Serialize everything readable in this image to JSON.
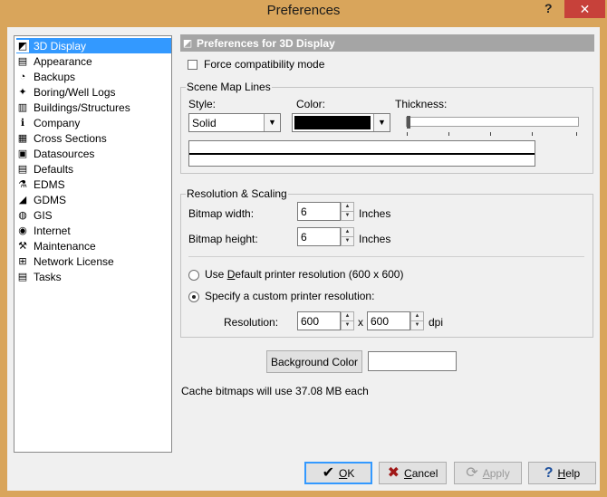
{
  "window": {
    "title": "Preferences",
    "help_glyph": "?",
    "close_glyph": "✕"
  },
  "nav": {
    "items": [
      {
        "label": "3D Display",
        "icon": "3d-display-icon",
        "glyph": "◩",
        "selected": true
      },
      {
        "label": "Appearance",
        "icon": "appearance-icon",
        "glyph": "▤"
      },
      {
        "label": "Backups",
        "icon": "backups-icon",
        "glyph": "◔"
      },
      {
        "label": "Boring/Well Logs",
        "icon": "boring-well-logs-icon",
        "glyph": "✦"
      },
      {
        "label": "Buildings/Structures",
        "icon": "buildings-icon",
        "glyph": "▥"
      },
      {
        "label": "Company",
        "icon": "company-icon",
        "glyph": "ℹ"
      },
      {
        "label": "Cross Sections",
        "icon": "cross-sections-icon",
        "glyph": "▦"
      },
      {
        "label": "Datasources",
        "icon": "datasources-icon",
        "glyph": "▣"
      },
      {
        "label": "Defaults",
        "icon": "defaults-icon",
        "glyph": "▤"
      },
      {
        "label": "EDMS",
        "icon": "edms-icon",
        "glyph": "⚗"
      },
      {
        "label": "GDMS",
        "icon": "gdms-icon",
        "glyph": "◢"
      },
      {
        "label": "GIS",
        "icon": "gis-icon",
        "glyph": "◍"
      },
      {
        "label": "Internet",
        "icon": "internet-icon",
        "glyph": "◉"
      },
      {
        "label": "Maintenance",
        "icon": "maintenance-icon",
        "glyph": "⚒"
      },
      {
        "label": "Network License",
        "icon": "network-license-icon",
        "glyph": "⊞"
      },
      {
        "label": "Tasks",
        "icon": "tasks-icon",
        "glyph": "▤"
      }
    ]
  },
  "panel": {
    "header": "Preferences for 3D Display",
    "force_compat_label": "Force compatibility mode",
    "scene_map_lines": {
      "title": "Scene Map Lines",
      "style_label": "Style:",
      "style_value": "Solid",
      "color_label": "Color:",
      "color_value": "#000000",
      "thickness_label": "Thickness:",
      "thickness_level": 0
    },
    "resolution": {
      "title": "Resolution & Scaling",
      "bitmap_width_label": "Bitmap width:",
      "bitmap_width_value": "6",
      "bitmap_width_unit": "Inches",
      "bitmap_height_label": "Bitmap height:",
      "bitmap_height_value": "6",
      "bitmap_height_unit": "Inches",
      "default_printer_pre": "Use ",
      "default_printer_u": "D",
      "default_printer_post": "efault printer resolution (600 x 600)",
      "custom_printer_label": "Specify a custom printer resolution:",
      "resolution_label": "Resolution:",
      "res_x": "600",
      "times": "x",
      "res_y": "600",
      "res_unit": "dpi"
    },
    "background_color_button": "Background Color",
    "background_color_value": "#ffffff",
    "cache_text": "Cache bitmaps will use 37.08 MB each"
  },
  "buttons": {
    "ok_u": "O",
    "ok_rest": "K",
    "cancel_u": "C",
    "cancel_rest": "ancel",
    "apply_u": "A",
    "apply_rest": "pply",
    "help_u": "H",
    "help_rest": "elp"
  }
}
